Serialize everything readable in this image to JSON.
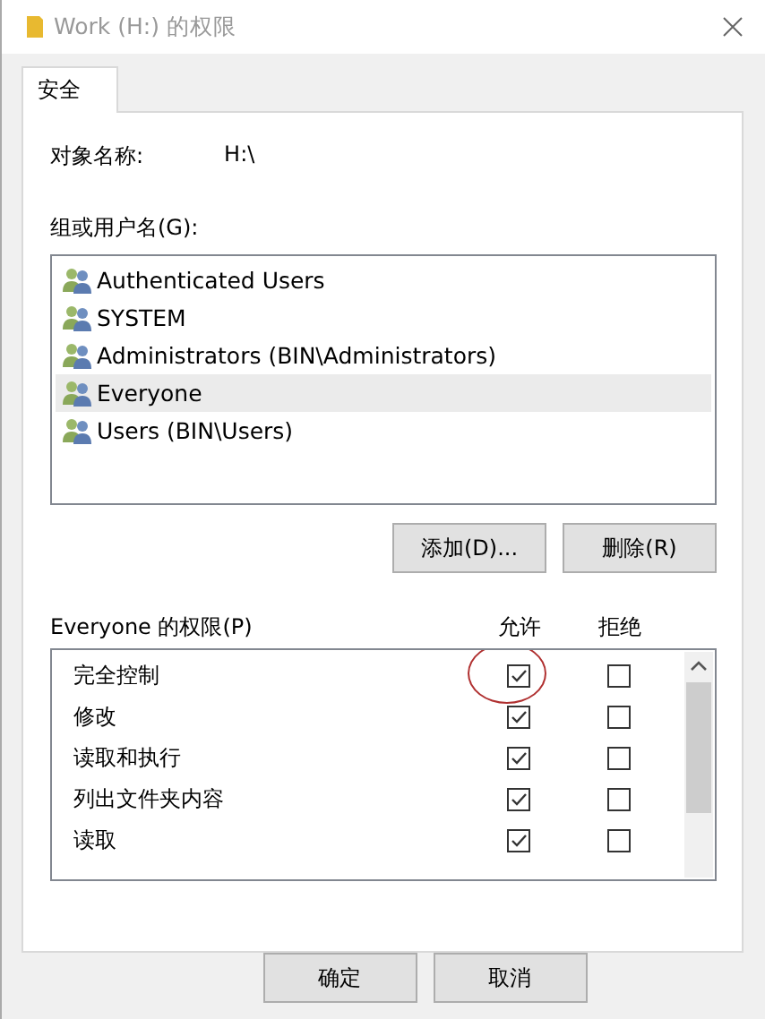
{
  "window": {
    "title": "Work (H:) 的权限"
  },
  "tabs": [
    {
      "label": "安全",
      "selected": true
    }
  ],
  "object_name": {
    "label": "对象名称:",
    "value": "H:\\"
  },
  "groups": {
    "label": "组或用户名(G):",
    "items": [
      {
        "name": "Authenticated Users",
        "selected": false
      },
      {
        "name": "SYSTEM",
        "selected": false
      },
      {
        "name": "Administrators (BIN\\Administrators)",
        "selected": false
      },
      {
        "name": "Everyone",
        "selected": true
      },
      {
        "name": "Users (BIN\\Users)",
        "selected": false
      }
    ]
  },
  "group_buttons": [
    "添加(D)...",
    "删除(R)"
  ],
  "permissions": {
    "label": "Everyone 的权限(P)",
    "allow_header": "允许",
    "deny_header": "拒绝",
    "items": [
      {
        "name": "完全控制",
        "allow": true,
        "deny": false,
        "circled": true
      },
      {
        "name": "修改",
        "allow": true,
        "deny": false,
        "circled": false
      },
      {
        "name": "读取和执行",
        "allow": true,
        "deny": false,
        "circled": false
      },
      {
        "name": "列出文件夹内容",
        "allow": true,
        "deny": false,
        "circled": false
      },
      {
        "name": "读取",
        "allow": true,
        "deny": false,
        "circled": false
      }
    ]
  },
  "buttons": [
    "确定",
    "取消"
  ]
}
